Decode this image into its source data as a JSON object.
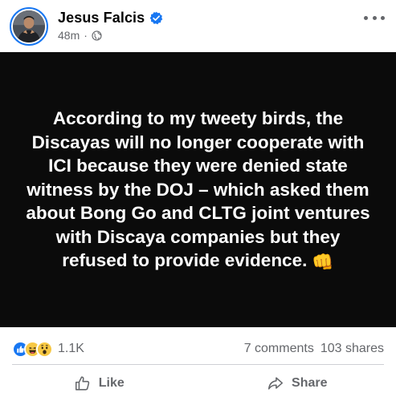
{
  "post": {
    "author_name": "Jesus Falcis",
    "time_ago": "48m",
    "meta_separator": "·",
    "privacy_icon": "globe-icon",
    "verified_icon": "verified-badge-icon",
    "body_text": "According to my tweety birds, the Discayas will no longer cooperate with ICI because they were denied state witness by the DOJ – which asked them about Bong Go and CLTG joint ventures with Discaya companies but they refused to provide evidence.",
    "body_emoji": "👊"
  },
  "stats": {
    "reactions": [
      "like",
      "haha",
      "wow"
    ],
    "reaction_count": "1.1K",
    "comments": "7 comments",
    "shares": "103 shares"
  },
  "actions": {
    "like_label": "Like",
    "share_label": "Share"
  },
  "colors": {
    "accent": "#1877f2",
    "card_bg": "#0b0b0b",
    "secondary_text": "#65676b"
  }
}
